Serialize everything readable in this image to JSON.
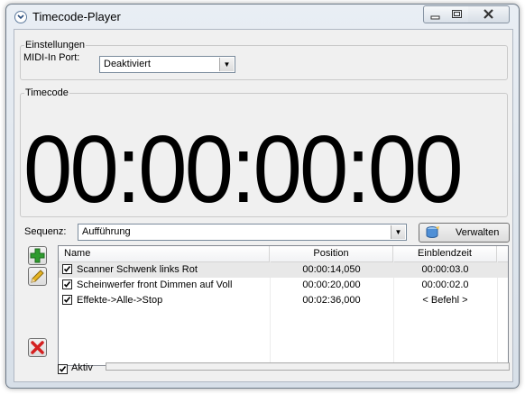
{
  "window": {
    "title": "Timecode-Player"
  },
  "settings": {
    "legend": "Einstellungen",
    "midi_label": "MIDI-In Port:",
    "midi_value": "Deaktiviert"
  },
  "timecode": {
    "legend": "Timecode",
    "display": "00:00:00:00"
  },
  "sequence": {
    "label": "Sequenz:",
    "value": "Aufführung",
    "manage_label": "Verwalten"
  },
  "cues": {
    "columns": [
      "Name",
      "Position",
      "Einblendzeit"
    ],
    "rows": [
      {
        "checked": true,
        "name": "Scanner Schwenk links Rot",
        "position": "00:00:14,050",
        "fade": "00:00:03.0"
      },
      {
        "checked": true,
        "name": "Scheinwerfer front Dimmen auf Voll",
        "position": "00:00:20,000",
        "fade": "00:00:02.0"
      },
      {
        "checked": true,
        "name": "Effekte->Alle->Stop",
        "position": "00:02:36,000",
        "fade": "< Befehl >"
      }
    ]
  },
  "status": {
    "active_label": "Aktiv",
    "active_checked": true
  },
  "colors": {
    "add": "#2e9b2e",
    "edit": "#e6b422",
    "delete": "#d42020"
  }
}
